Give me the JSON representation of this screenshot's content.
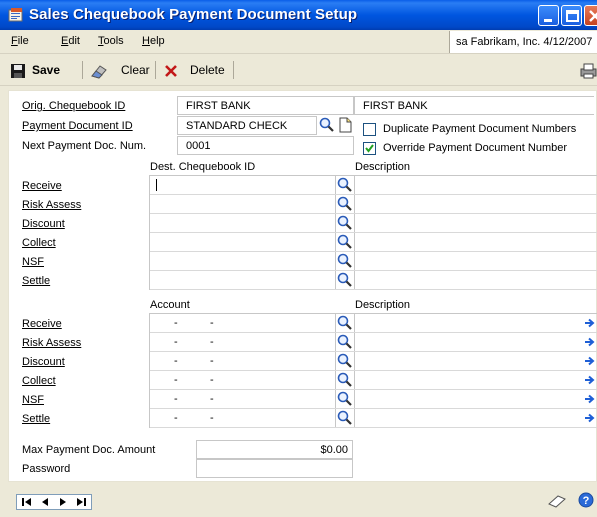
{
  "window": {
    "title": "Sales Chequebook Payment Document Setup"
  },
  "menu": {
    "items": [
      {
        "label": "File",
        "underline": "F",
        "rest": "ile"
      },
      {
        "label": "Edit",
        "underline": "E",
        "rest": "dit"
      },
      {
        "label": "Tools",
        "underline": "T",
        "rest": "ools"
      },
      {
        "label": "Help",
        "underline": "H",
        "rest": "elp"
      }
    ],
    "company_info": "sa  Fabrikam, Inc.  4/12/2007"
  },
  "toolbar": {
    "save_label": "Save",
    "clear_label": "Clear",
    "delete_label": "Delete"
  },
  "form": {
    "orig_chequebook_label": "Orig. Chequebook ID",
    "orig_chequebook_value": "FIRST BANK",
    "orig_chequebook_desc": "FIRST BANK",
    "payment_doc_id_label": "Payment Document ID",
    "payment_doc_id_value": "STANDARD CHECK",
    "next_payment_label": "Next Payment Doc. Num.",
    "next_payment_value": "0001",
    "duplicate_label": "Duplicate Payment Document Numbers",
    "duplicate_checked": false,
    "override_label": "Override Payment Document Number",
    "override_checked": true
  },
  "dest_section": {
    "col_dest": "Dest. Chequebook ID",
    "col_desc": "Description",
    "rows": [
      {
        "label": "Receive",
        "value": "",
        "desc": ""
      },
      {
        "label": "Risk Assess",
        "value": "",
        "desc": ""
      },
      {
        "label": "Discount",
        "value": "",
        "desc": ""
      },
      {
        "label": "Collect",
        "value": "",
        "desc": ""
      },
      {
        "label": "NSF",
        "value": "",
        "desc": ""
      },
      {
        "label": "Settle",
        "value": "",
        "desc": ""
      }
    ]
  },
  "account_section": {
    "col_account": "Account",
    "col_desc": "Description",
    "rows": [
      {
        "label": "Receive",
        "seg1": "-",
        "seg2": "-",
        "desc": ""
      },
      {
        "label": "Risk Assess",
        "seg1": "-",
        "seg2": "-",
        "desc": ""
      },
      {
        "label": "Discount",
        "seg1": "-",
        "seg2": "-",
        "desc": ""
      },
      {
        "label": "Collect",
        "seg1": "-",
        "seg2": "-",
        "desc": ""
      },
      {
        "label": "NSF",
        "seg1": "-",
        "seg2": "-",
        "desc": ""
      },
      {
        "label": "Settle",
        "seg1": "-",
        "seg2": "-",
        "desc": ""
      }
    ]
  },
  "limits": {
    "max_amount_label": "Max Payment Doc. Amount",
    "max_amount_value": "$0.00",
    "password_label": "Password",
    "password_value": ""
  },
  "colors": {
    "titlebar": "#0054e3",
    "window_bg": "#ece9d8",
    "lookup_blue": "#2a5bb8",
    "arrow_blue": "#1e5fd6"
  }
}
